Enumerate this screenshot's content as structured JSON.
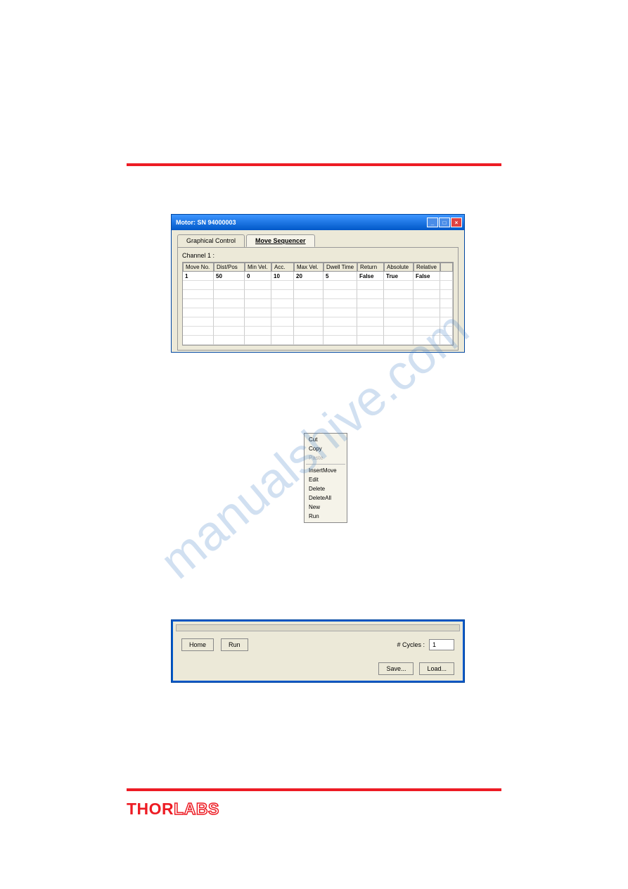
{
  "window": {
    "title": "Motor: SN 94000003"
  },
  "tabs": {
    "graphical": "Graphical Control",
    "sequencer": "Move Sequencer"
  },
  "channel_label": "Channel 1 :",
  "table": {
    "headers": {
      "moveno": "Move No.",
      "distpos": "Dist/Pos",
      "minvel": "Min Vel.",
      "acc": "Acc.",
      "maxvel": "Max Vel.",
      "dwell": "Dwell Time",
      "return": "Return",
      "absolute": "Absolute",
      "relative": "Relative"
    },
    "row": {
      "moveno": "1",
      "distpos": "50",
      "minvel": "0",
      "acc": "10",
      "maxvel": "20",
      "dwell": "5",
      "return": "False",
      "absolute": "True",
      "relative": "False"
    }
  },
  "context": {
    "cut": "Cut",
    "copy": "Copy",
    "paste": "Paste",
    "insert": "InsertMove",
    "edit": "Edit",
    "delete": "Delete",
    "deleteall": "DeleteAll",
    "new": "New",
    "run": "Run"
  },
  "buttons": {
    "home": "Home",
    "run": "Run",
    "save": "Save...",
    "load": "Load..."
  },
  "cycles": {
    "label": "# Cycles :",
    "value": "1"
  },
  "logo": {
    "thor": "THOR",
    "labs": "LABS"
  },
  "watermark": "manualshive.com"
}
